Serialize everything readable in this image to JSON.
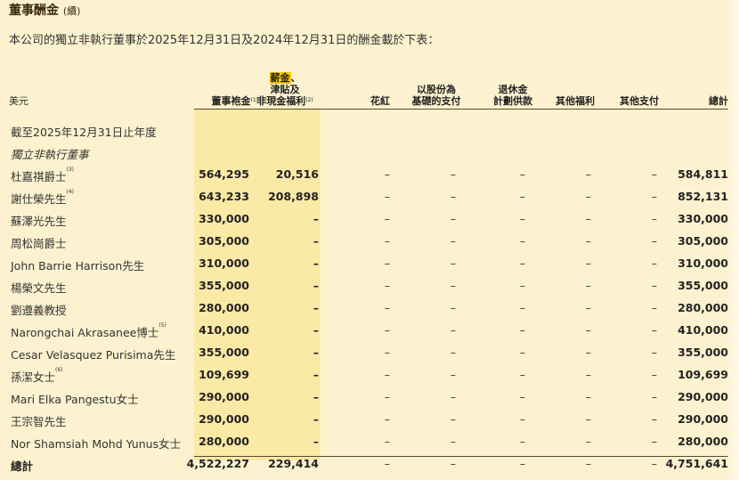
{
  "header": {
    "title": "董事酬金",
    "title_suffix": "(續)",
    "intro": "本公司的獨立非執行董事於2025年12月31日及2024年12月31日的酬金載於下表："
  },
  "columns": {
    "unit": "美元",
    "fees": "董事袍金",
    "fees_note": "(1)",
    "salary_line1": "薪金",
    "salary_line1_tail": "、",
    "salary_line2": "津貼及",
    "salary_line3": "非現金福利",
    "salary_note": "(2)",
    "bonus": "花紅",
    "share_line1": "以股份為",
    "share_line2": "基礎的支付",
    "pension_line1": "退休金",
    "pension_line2": "計劃供款",
    "other_benefits": "其他福利",
    "other_payments": "其他支付",
    "total": "總計"
  },
  "section": {
    "period": "截至2025年12月31日止年度",
    "group": "獨立非執行董事"
  },
  "rows": [
    {
      "name": "杜嘉祺爵士",
      "note": "(3)",
      "fees": "564,295",
      "salary": "20,516",
      "bonus": "–",
      "share": "–",
      "pension": "–",
      "other_benefits": "–",
      "other_payments": "–",
      "total": "584,811"
    },
    {
      "name": "謝仕榮先生",
      "note": "(4)",
      "fees": "643,233",
      "salary": "208,898",
      "bonus": "–",
      "share": "–",
      "pension": "–",
      "other_benefits": "–",
      "other_payments": "–",
      "total": "852,131"
    },
    {
      "name": "蘇澤光先生",
      "note": "",
      "fees": "330,000",
      "salary": "–",
      "bonus": "–",
      "share": "–",
      "pension": "–",
      "other_benefits": "–",
      "other_payments": "–",
      "total": "330,000"
    },
    {
      "name": "周松崗爵士",
      "note": "",
      "fees": "305,000",
      "salary": "–",
      "bonus": "–",
      "share": "–",
      "pension": "–",
      "other_benefits": "–",
      "other_payments": "–",
      "total": "305,000"
    },
    {
      "name": "John Barrie Harrison先生",
      "note": "",
      "fees": "310,000",
      "salary": "–",
      "bonus": "–",
      "share": "–",
      "pension": "–",
      "other_benefits": "–",
      "other_payments": "–",
      "total": "310,000"
    },
    {
      "name": "楊榮文先生",
      "note": "",
      "fees": "355,000",
      "salary": "–",
      "bonus": "–",
      "share": "–",
      "pension": "–",
      "other_benefits": "–",
      "other_payments": "–",
      "total": "355,000"
    },
    {
      "name": "劉遵義教授",
      "note": "",
      "fees": "280,000",
      "salary": "–",
      "bonus": "–",
      "share": "–",
      "pension": "–",
      "other_benefits": "–",
      "other_payments": "–",
      "total": "280,000"
    },
    {
      "name": "Narongchai Akrasanee博士",
      "note": "(5)",
      "fees": "410,000",
      "salary": "–",
      "bonus": "–",
      "share": "–",
      "pension": "–",
      "other_benefits": "–",
      "other_payments": "–",
      "total": "410,000"
    },
    {
      "name": "Cesar Velasquez Purisima先生",
      "note": "",
      "fees": "355,000",
      "salary": "–",
      "bonus": "–",
      "share": "–",
      "pension": "–",
      "other_benefits": "–",
      "other_payments": "–",
      "total": "355,000"
    },
    {
      "name": "孫潔女士",
      "note": "(6)",
      "fees": "109,699",
      "salary": "–",
      "bonus": "–",
      "share": "–",
      "pension": "–",
      "other_benefits": "–",
      "other_payments": "–",
      "total": "109,699"
    },
    {
      "name": "Mari Elka Pangestu女士",
      "note": "",
      "fees": "290,000",
      "salary": "–",
      "bonus": "–",
      "share": "–",
      "pension": "–",
      "other_benefits": "–",
      "other_payments": "–",
      "total": "290,000"
    },
    {
      "name": "王宗智先生",
      "note": "",
      "fees": "290,000",
      "salary": "–",
      "bonus": "–",
      "share": "–",
      "pension": "–",
      "other_benefits": "–",
      "other_payments": "–",
      "total": "290,000"
    },
    {
      "name": "Nor Shamsiah Mohd Yunus女士",
      "note": "",
      "fees": "280,000",
      "salary": "–",
      "bonus": "–",
      "share": "–",
      "pension": "–",
      "other_benefits": "–",
      "other_payments": "–",
      "total": "280,000"
    }
  ],
  "total_row": {
    "name": "總計",
    "fees": "4,522,227",
    "salary": "229,414",
    "bonus": "–",
    "share": "–",
    "pension": "–",
    "other_benefits": "–",
    "other_payments": "–",
    "total": "4,751,641"
  },
  "colors": {
    "page_background": "#fdf2cf",
    "column_shade": "#fbe9a6",
    "highlight": "#f7c600"
  }
}
